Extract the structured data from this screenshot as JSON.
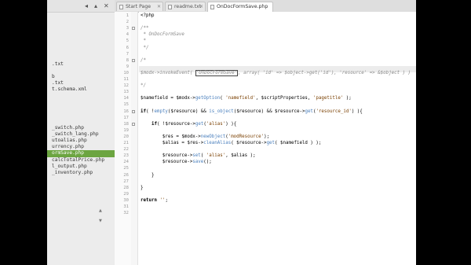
{
  "sidebar": {
    "controls": [
      "◂",
      "▴",
      "✕"
    ],
    "scroll_up": "▲",
    "scroll_down": "▼",
    "files": [
      {
        "label": "",
        "selected": false
      },
      {
        "label": ".txt",
        "selected": false
      },
      {
        "label": "",
        "selected": false
      },
      {
        "label": "b",
        "selected": false
      },
      {
        "label": ".txt",
        "selected": false
      },
      {
        "label": "t.schema.xml",
        "selected": false
      },
      {
        "label": "",
        "selected": false
      },
      {
        "label": "",
        "selected": false
      },
      {
        "label": "",
        "selected": false
      },
      {
        "label": "",
        "selected": false
      },
      {
        "label": "",
        "selected": false
      },
      {
        "label": "_switch.php",
        "selected": false
      },
      {
        "label": "_switch_lang.php",
        "selected": false
      },
      {
        "label": "utoalias.php",
        "selected": false
      },
      {
        "label": "urrency.php",
        "selected": false
      },
      {
        "label": "ormSave.php",
        "selected": true
      },
      {
        "label": "calcTotalPrice.php",
        "selected": false
      },
      {
        "label": "l_output.php",
        "selected": false
      },
      {
        "label": "_inventory.php",
        "selected": false
      }
    ]
  },
  "tabs": [
    {
      "label": "Start Page",
      "active": false
    },
    {
      "label": "readme.txt",
      "active": false
    },
    {
      "label": "OnDocFormSave.php",
      "active": true
    }
  ],
  "tab_close": "✕",
  "lines": [
    {
      "n": "1",
      "segs": [
        {
          "t": "<?php",
          "c": ""
        }
      ]
    },
    {
      "n": "2",
      "segs": []
    },
    {
      "n": "3",
      "segs": [
        {
          "t": "/**",
          "c": "cmt"
        }
      ]
    },
    {
      "n": "4",
      "segs": [
        {
          "t": " * OnDocFormSave",
          "c": "cmt"
        }
      ]
    },
    {
      "n": "5",
      "segs": [
        {
          "t": " *",
          "c": "cmt"
        }
      ]
    },
    {
      "n": "6",
      "segs": [
        {
          "t": " */",
          "c": "cmt"
        }
      ]
    },
    {
      "n": "7",
      "segs": []
    },
    {
      "n": "8",
      "segs": [
        {
          "t": "/*",
          "c": "cmt"
        }
      ]
    },
    {
      "n": "9",
      "segs": []
    },
    {
      "n": "10",
      "segs": [
        {
          "t": "$modx->invokeEvent( ",
          "c": "cmt"
        },
        {
          "t": "'OnDocFormSave'",
          "c": "cmt sel-box"
        },
        {
          "t": ", array( 'id' => $object->get('id'), 'resource' => &$object ) )",
          "c": "cmt"
        }
      ]
    },
    {
      "n": "11",
      "segs": []
    },
    {
      "n": "12",
      "segs": [
        {
          "t": "*/",
          "c": "cmt"
        }
      ]
    },
    {
      "n": "13",
      "segs": []
    },
    {
      "n": "14",
      "segs": [
        {
          "t": "$namefield = $modx->",
          "c": ""
        },
        {
          "t": "getOption",
          "c": "fn"
        },
        {
          "t": "( ",
          "c": ""
        },
        {
          "t": "'namefield'",
          "c": "str"
        },
        {
          "t": ", $scriptProperties, ",
          "c": ""
        },
        {
          "t": "'pagetitle'",
          "c": "str"
        },
        {
          "t": " );",
          "c": ""
        }
      ]
    },
    {
      "n": "15",
      "segs": []
    },
    {
      "n": "16",
      "segs": [
        {
          "t": "if",
          "c": "kw"
        },
        {
          "t": "( !",
          "c": ""
        },
        {
          "t": "empty",
          "c": "fn"
        },
        {
          "t": "($resource) && ",
          "c": ""
        },
        {
          "t": "is_object",
          "c": "fn"
        },
        {
          "t": "($resource) && $resource->",
          "c": ""
        },
        {
          "t": "get",
          "c": "fn"
        },
        {
          "t": "(",
          "c": ""
        },
        {
          "t": "'resource_id'",
          "c": "str"
        },
        {
          "t": ") ){",
          "c": ""
        }
      ]
    },
    {
      "n": "17",
      "segs": []
    },
    {
      "n": "18",
      "segs": [
        {
          "t": "    ",
          "c": ""
        },
        {
          "t": "if",
          "c": "kw"
        },
        {
          "t": "( !$resource->",
          "c": ""
        },
        {
          "t": "get",
          "c": "fn"
        },
        {
          "t": "(",
          "c": ""
        },
        {
          "t": "'alias'",
          "c": "str"
        },
        {
          "t": ") ){",
          "c": ""
        }
      ]
    },
    {
      "n": "19",
      "segs": []
    },
    {
      "n": "20",
      "segs": [
        {
          "t": "        $res = $modx->",
          "c": ""
        },
        {
          "t": "newObject",
          "c": "fn"
        },
        {
          "t": "(",
          "c": ""
        },
        {
          "t": "'modResource'",
          "c": "str"
        },
        {
          "t": ");",
          "c": ""
        }
      ]
    },
    {
      "n": "21",
      "segs": [
        {
          "t": "        $alias = $res->",
          "c": ""
        },
        {
          "t": "cleanAlias",
          "c": "fn"
        },
        {
          "t": "( $resource->",
          "c": ""
        },
        {
          "t": "get",
          "c": "fn"
        },
        {
          "t": "( $namefield ) );",
          "c": ""
        }
      ]
    },
    {
      "n": "22",
      "segs": []
    },
    {
      "n": "23",
      "segs": [
        {
          "t": "        $resource->",
          "c": ""
        },
        {
          "t": "set",
          "c": "fn"
        },
        {
          "t": "( ",
          "c": ""
        },
        {
          "t": "'alias'",
          "c": "str"
        },
        {
          "t": ", $alias );",
          "c": ""
        }
      ]
    },
    {
      "n": "24",
      "segs": [
        {
          "t": "        $resource->",
          "c": ""
        },
        {
          "t": "save",
          "c": "fn"
        },
        {
          "t": "();",
          "c": ""
        }
      ]
    },
    {
      "n": "25",
      "segs": []
    },
    {
      "n": "26",
      "segs": [
        {
          "t": "    }",
          "c": ""
        }
      ]
    },
    {
      "n": "27",
      "segs": []
    },
    {
      "n": "28",
      "segs": [
        {
          "t": "}",
          "c": ""
        }
      ]
    },
    {
      "n": "29",
      "segs": []
    },
    {
      "n": "30",
      "segs": [
        {
          "t": "return",
          "c": "kw"
        },
        {
          "t": " ",
          "c": ""
        },
        {
          "t": "''",
          "c": "str"
        },
        {
          "t": ";",
          "c": ""
        }
      ]
    },
    {
      "n": "31",
      "segs": []
    },
    {
      "n": "32",
      "segs": []
    }
  ]
}
